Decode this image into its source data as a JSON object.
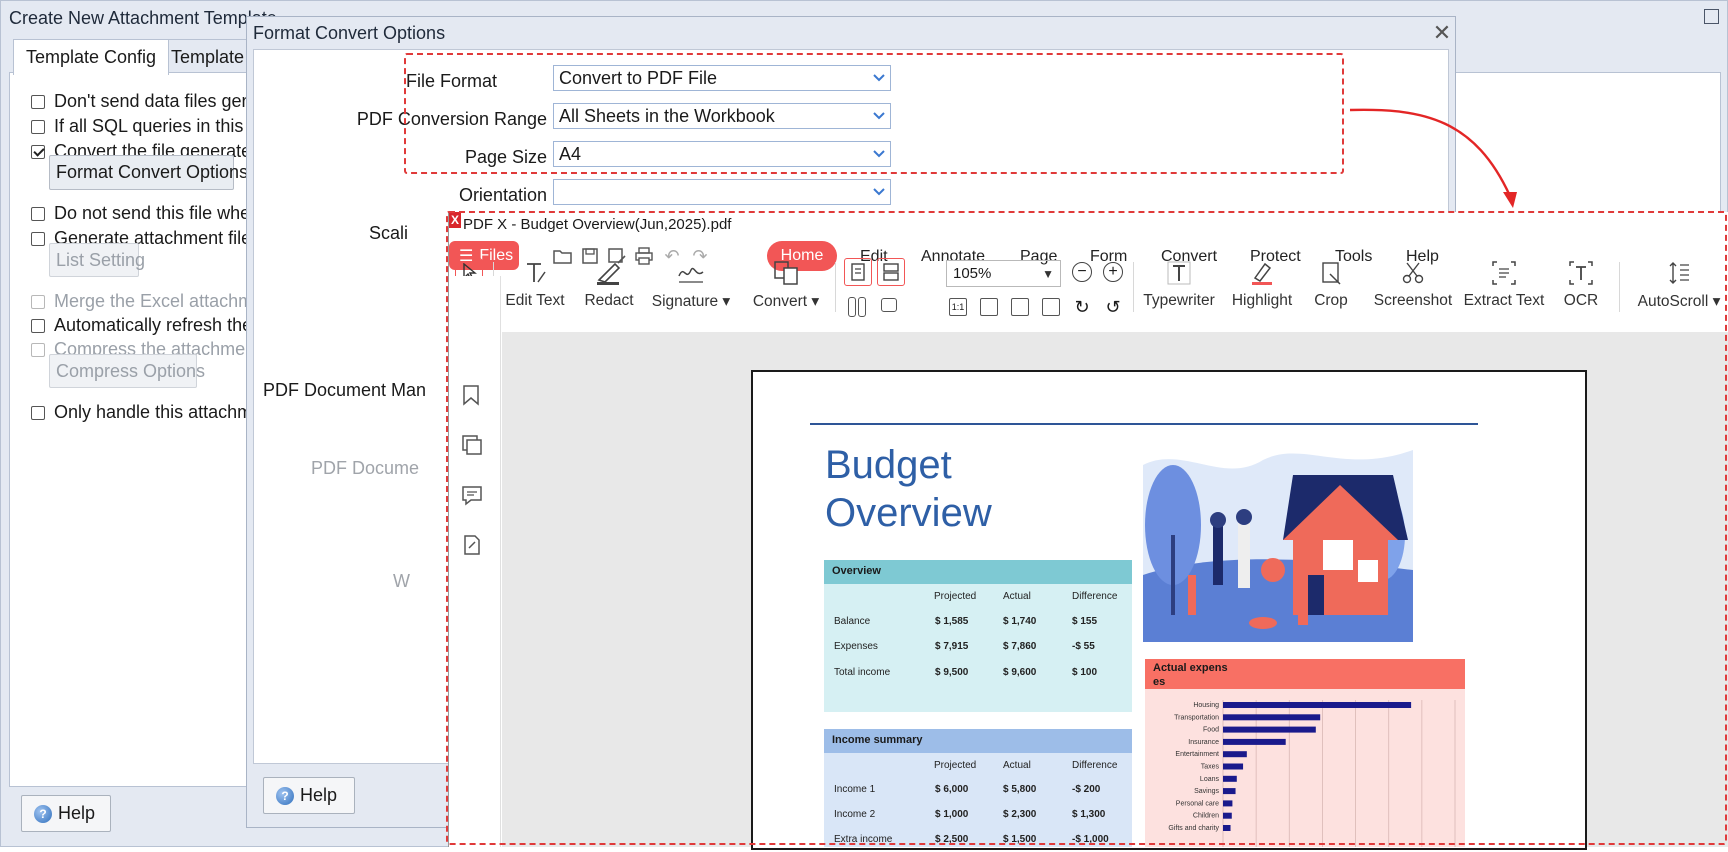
{
  "back_window": {
    "title": "Create New Attachment Template",
    "tabs": [
      "Template Config",
      "Template V"
    ],
    "options": [
      {
        "label": "Don't send data files genera",
        "checked": false,
        "disabled": false
      },
      {
        "label": "If all SQL queries in this tem",
        "checked": false,
        "disabled": false
      },
      {
        "label": "Convert the file generated b",
        "checked": true,
        "disabled": false
      },
      {
        "label": "Do not send this file when s",
        "checked": false,
        "disabled": false
      },
      {
        "label": "Generate attachment files r",
        "checked": false,
        "disabled": false
      },
      {
        "label": "Merge the Excel attachmen",
        "checked": false,
        "disabled": true
      },
      {
        "label": "Automatically refresh the fo",
        "checked": false,
        "disabled": false
      },
      {
        "label": "Compress the attachment fi",
        "checked": false,
        "disabled": true
      },
      {
        "label": "Only handle this attachmen",
        "checked": false,
        "disabled": false
      }
    ],
    "format_convert_button": "Format Convert Options",
    "list_setting_button": "List Setting",
    "compress_options_button": "Compress Options",
    "help_button": "Help"
  },
  "mid_window": {
    "title": "Format Convert Options",
    "close_icon": "close-icon",
    "rows": [
      {
        "label": "File Format",
        "value": "Convert to PDF File"
      },
      {
        "label": "PDF Conversion Range",
        "value": "All Sheets in the Workbook"
      },
      {
        "label": "Page Size",
        "value": "A4"
      },
      {
        "label": "Orientation",
        "value": ""
      }
    ],
    "partial_labels": [
      "Scali",
      "PDF Document Man",
      "PDF Docume",
      "W"
    ],
    "help_button": "Help"
  },
  "pdf_window": {
    "title": "PDF X - Budget Overview(Jun,2025).pdf",
    "logo": "X",
    "files_button": "Files",
    "menus": [
      "Home",
      "Edit",
      "Annotate",
      "Page",
      "Form",
      "Convert",
      "Protect",
      "Tools",
      "Help"
    ],
    "tools": [
      "Edit Text",
      "Redact",
      "Signature",
      "Convert",
      "Typewriter",
      "Highlight",
      "Crop",
      "Screenshot",
      "Extract Text",
      "OCR",
      "AutoScroll"
    ],
    "zoom": "105%",
    "accent": "#f25656"
  },
  "document": {
    "title_line1": "Budget",
    "title_line2": "Overview",
    "overview": {
      "heading": "Overview",
      "columns": [
        "Projected",
        "Actual",
        "Difference"
      ],
      "rows": [
        {
          "label": "Balance",
          "values": [
            "$ 1,585",
            "$ 1,740",
            "$ 155"
          ]
        },
        {
          "label": "Expenses",
          "values": [
            "$ 7,915",
            "$ 7,860",
            "-$ 55"
          ]
        },
        {
          "label": "Total income",
          "values": [
            "$ 9,500",
            "$ 9,600",
            "$ 100"
          ]
        }
      ]
    },
    "income": {
      "heading": "Income summary",
      "columns": [
        "Projected",
        "Actual",
        "Difference"
      ],
      "rows": [
        {
          "label": "Income 1",
          "values": [
            "$ 6,000",
            "$ 5,800",
            "-$ 200"
          ]
        },
        {
          "label": "Income 2",
          "values": [
            "$ 1,000",
            "$ 2,300",
            "$ 1,300"
          ]
        },
        {
          "label": "Extra income",
          "values": [
            "$ 2,500",
            "$ 1,500",
            "-$ 1,000"
          ]
        }
      ]
    },
    "expenses_chart": {
      "heading_line1": "Actual expens",
      "heading_line2": "es"
    }
  },
  "chart_data": {
    "type": "bar",
    "title": "Actual expenses",
    "categories": [
      "Housing",
      "Transportation",
      "Food",
      "Insurance",
      "Entertainment",
      "Taxes",
      "Loans",
      "Savings",
      "Personal care",
      "Children",
      "Gifts and charity"
    ],
    "values": [
      3000,
      1550,
      1480,
      1000,
      380,
      320,
      220,
      200,
      150,
      140,
      120
    ],
    "xlim": [
      0,
      3700
    ],
    "grid": true
  }
}
